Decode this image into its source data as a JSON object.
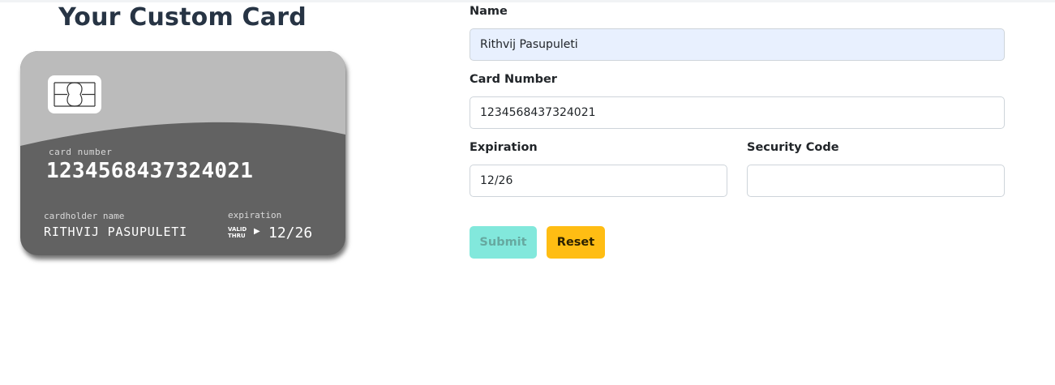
{
  "card_preview": {
    "title": "Your Custom Card",
    "card_number_label": "card number",
    "card_number": "1234568437324021",
    "cardholder_label": "cardholder name",
    "cardholder_name": "RITHVIJ PASUPULETI",
    "expiration_label": "expiration",
    "valid_thru_line1": "VALID",
    "valid_thru_line2": "THRU",
    "valid_arrow": "▶",
    "expiration": "12/26",
    "colors": {
      "card_top": "#bbbbbb",
      "card_body": "#626262",
      "chip": "#ffffff"
    }
  },
  "form": {
    "name_label": "Name",
    "name_value": "Rithvij Pasupuleti",
    "card_number_label": "Card Number",
    "card_number_value": "1234568437324021",
    "expiration_label": "Expiration",
    "expiration_value": "12/26",
    "security_code_label": "Security Code",
    "security_code_value": "",
    "submit_label": "Submit",
    "reset_label": "Reset",
    "colors": {
      "submit": "#82e8dc",
      "reset": "#ffbd13",
      "autofill": "#e8f0fe"
    }
  }
}
